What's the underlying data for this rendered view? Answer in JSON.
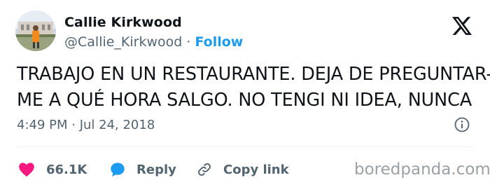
{
  "tweet": {
    "author_name": "Callie Kirkwood",
    "handle": "@Callie_Kirkwood",
    "separator": " · ",
    "follow_label": "Follow",
    "text_lines": [
      "TRABAJO EN UN RESTAURANTE. DEJA DE PREGUNTAR-",
      "ME A QUÉ HORA SALGO. NO TENGI NI IDEA, NUNCA"
    ],
    "timestamp": "4:49 PM · Jul 24, 2018",
    "like_count": "66.1K",
    "reply_label": "Reply",
    "copy_link_label": "Copy link"
  },
  "icons": {
    "platform": "x-logo-icon",
    "info": "info-icon",
    "like": "heart-icon",
    "reply": "reply-bubble-icon",
    "copy": "link-icon"
  },
  "colors": {
    "accent": "#1d9bf0",
    "heart": "#f91880",
    "muted_text": "#536471",
    "primary_text": "#0f1419"
  },
  "watermark": "boredpanda.com"
}
